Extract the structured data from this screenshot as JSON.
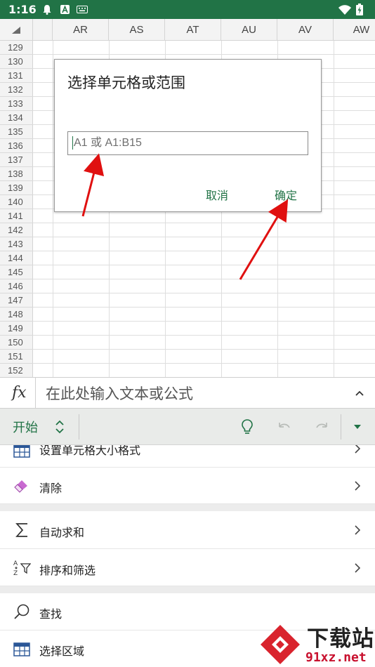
{
  "status_bar": {
    "time": "1:16",
    "icons": [
      "notification-bell-icon",
      "app-a-icon",
      "keyboard-icon",
      "wifi-icon",
      "battery-charging-icon"
    ]
  },
  "sheet": {
    "columns": [
      "AR",
      "AS",
      "AT",
      "AU",
      "AV",
      "AW"
    ],
    "rows": [
      "129",
      "130",
      "131",
      "132",
      "133",
      "134",
      "135",
      "136",
      "137",
      "138",
      "139",
      "140",
      "141",
      "142",
      "143",
      "144",
      "145",
      "146",
      "147",
      "148",
      "149",
      "150",
      "151",
      "152"
    ]
  },
  "dialog": {
    "title": "选择单元格或范围",
    "input_placeholder": "A1 或 A1:B15",
    "cancel_label": "取消",
    "confirm_label": "确定"
  },
  "formula_bar": {
    "fx_label": "fx",
    "placeholder": "在此处输入文本或公式"
  },
  "ribbon": {
    "tab_label": "开始",
    "icons": [
      "tab-switch-icon",
      "lightbulb-icon",
      "undo-icon",
      "redo-icon",
      "dropdown-icon"
    ]
  },
  "menu": {
    "items": [
      {
        "label": "设置单元格大小格式",
        "icon": "grid-table-icon"
      },
      {
        "label": "清除",
        "icon": "eraser-icon"
      },
      {
        "label": "自动求和",
        "icon": "sigma-icon"
      },
      {
        "label": "排序和筛选",
        "icon": "sort-filter-icon"
      },
      {
        "label": "查找",
        "icon": "search-icon"
      },
      {
        "label": "选择区域",
        "icon": "grid-table-icon"
      }
    ]
  },
  "watermark": {
    "text": "下载站",
    "url": "91xz.net"
  },
  "colors": {
    "accent": "#217346",
    "ribbon_bg": "#e9ebe9",
    "arrow": "#e01010"
  }
}
